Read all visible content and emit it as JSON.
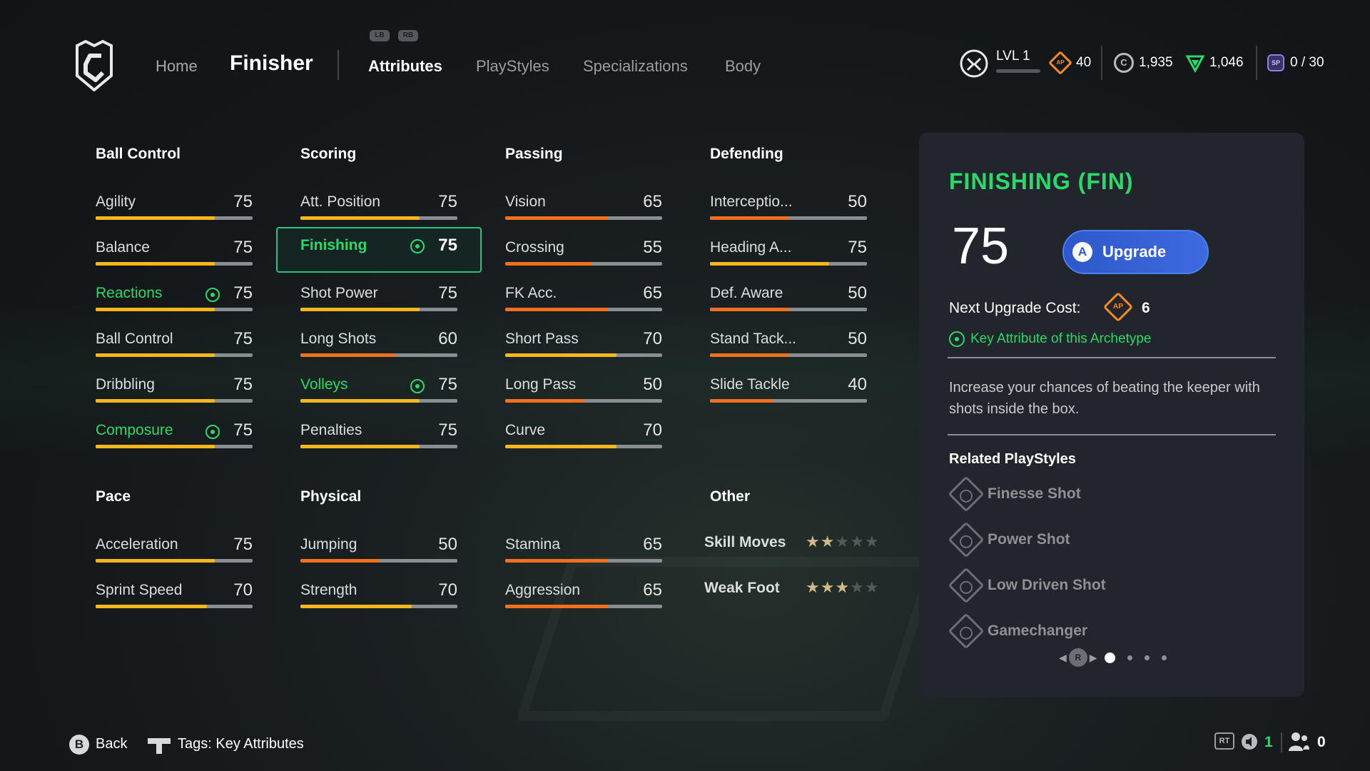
{
  "nav": {
    "home": "Home",
    "title": "Finisher",
    "lb": "LB",
    "rb": "RB",
    "tabs": [
      "Attributes",
      "PlayStyles",
      "Specializations",
      "Body"
    ],
    "active_tab": "Attributes"
  },
  "hud": {
    "level": "LVL 1",
    "ap": "40",
    "ap_icon": "AP",
    "coins": "1,935",
    "coins_icon": "C",
    "vp": "1,046",
    "sp": "0 / 30",
    "sp_icon": "SP"
  },
  "categories": {
    "ball_control": "Ball Control",
    "scoring": "Scoring",
    "passing": "Passing",
    "defending": "Defending",
    "pace": "Pace",
    "physical": "Physical",
    "other": "Other"
  },
  "attributes": {
    "ball_control": [
      {
        "name": "Agility",
        "value": "75",
        "key": false
      },
      {
        "name": "Balance",
        "value": "75",
        "key": false
      },
      {
        "name": "Reactions",
        "value": "75",
        "key": true
      },
      {
        "name": "Ball Control",
        "value": "75",
        "key": false
      },
      {
        "name": "Dribbling",
        "value": "75",
        "key": false
      },
      {
        "name": "Composure",
        "value": "75",
        "key": true
      }
    ],
    "scoring": [
      {
        "name": "Att. Position",
        "value": "75",
        "key": false
      },
      {
        "name": "Finishing",
        "value": "75",
        "key": true,
        "selected": true
      },
      {
        "name": "Shot Power",
        "value": "75",
        "key": false
      },
      {
        "name": "Long Shots",
        "value": "60",
        "key": false
      },
      {
        "name": "Volleys",
        "value": "75",
        "key": true
      },
      {
        "name": "Penalties",
        "value": "75",
        "key": false
      }
    ],
    "passing": [
      {
        "name": "Vision",
        "value": "65",
        "key": false
      },
      {
        "name": "Crossing",
        "value": "55",
        "key": false
      },
      {
        "name": "FK Acc.",
        "value": "65",
        "key": false
      },
      {
        "name": "Short Pass",
        "value": "70",
        "key": false
      },
      {
        "name": "Long Pass",
        "value": "50",
        "key": false
      },
      {
        "name": "Curve",
        "value": "70",
        "key": false
      }
    ],
    "defending": [
      {
        "name": "Interceptio...",
        "value": "50",
        "key": false
      },
      {
        "name": "Heading A...",
        "value": "75",
        "key": false
      },
      {
        "name": "Def. Aware",
        "value": "50",
        "key": false
      },
      {
        "name": "Stand Tack...",
        "value": "50",
        "key": false
      },
      {
        "name": "Slide Tackle",
        "value": "40",
        "key": false
      }
    ],
    "pace": [
      {
        "name": "Acceleration",
        "value": "75",
        "key": false
      },
      {
        "name": "Sprint Speed",
        "value": "70",
        "key": false
      }
    ],
    "physical": [
      {
        "name": "Jumping",
        "value": "50",
        "key": false
      },
      {
        "name": "Strength",
        "value": "70",
        "key": false
      }
    ],
    "physical2": [
      {
        "name": "Stamina",
        "value": "65",
        "key": false
      },
      {
        "name": "Aggression",
        "value": "65",
        "key": false
      }
    ]
  },
  "other": [
    {
      "name": "Skill Moves",
      "stars": 2,
      "max": 5
    },
    {
      "name": "Weak Foot",
      "stars": 3,
      "max": 5
    }
  ],
  "colors": {
    "key_green": "#2bd96b",
    "bar_high": "#f5b71e",
    "bar_low": "#f0701e",
    "upgrade_blue": "#2c58c9",
    "ap_orange": "#f08a2a"
  },
  "panel": {
    "title": "FINISHING (FIN)",
    "value": "75",
    "upgrade_button_glyph": "A",
    "upgrade_label": "Upgrade",
    "cost_label": "Next Upgrade Cost:",
    "cost_icon": "AP",
    "cost_value": "6",
    "key_note": "Key Attribute of this Archetype",
    "description": "Increase your chances of beating the keeper with shots inside the box.",
    "related_title": "Related PlayStyles",
    "playstyles": [
      "Finesse Shot",
      "Power Shot",
      "Low Driven Shot",
      "Gamechanger"
    ],
    "pager_button": "R",
    "pager_pages": 4,
    "pager_current": 1
  },
  "bottom": {
    "back_button": "B",
    "back_label": "Back",
    "tags_label": "Tags: Key Attributes",
    "rt": "RT",
    "count_a": "1",
    "count_b": "0"
  }
}
